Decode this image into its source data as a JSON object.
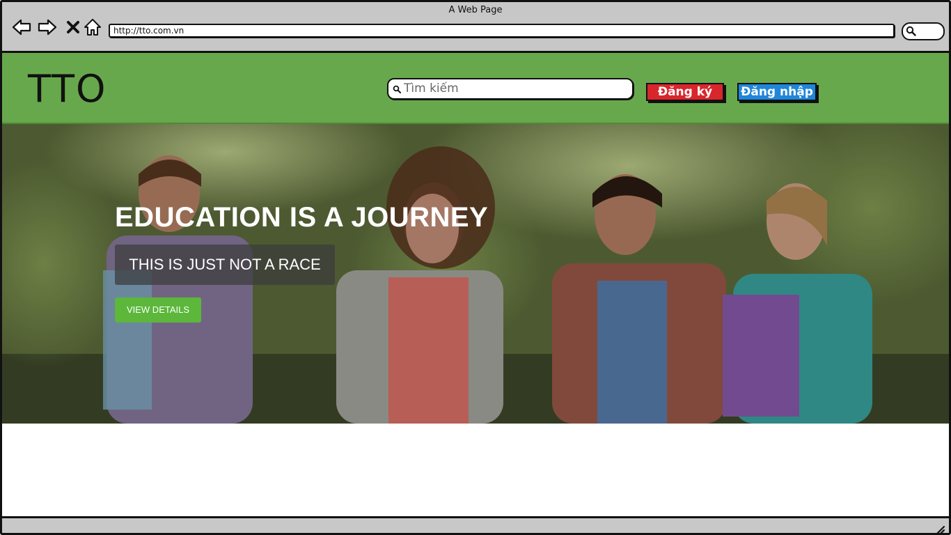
{
  "browser": {
    "window_title": "A Web Page",
    "url": "http://tto.com.vn",
    "nav_icons": [
      "back-arrow-icon",
      "forward-arrow-icon",
      "close-x-icon",
      "home-icon"
    ],
    "search_icon": "search-icon"
  },
  "header": {
    "logo": "TTO",
    "background_color": "#68a84d",
    "search": {
      "placeholder": "Tìm kiếm",
      "value": "",
      "icon": "search-icon"
    },
    "register_label": "Đăng ký",
    "register_color": "#d9262d",
    "login_label": "Đăng nhập",
    "login_color": "#1f86d9"
  },
  "hero": {
    "title": "EDUCATION IS A JOURNEY",
    "subtitle": "THIS IS JUST NOT A RACE",
    "button_label": "VIEW DETAILS",
    "button_color": "#5cb73b"
  }
}
